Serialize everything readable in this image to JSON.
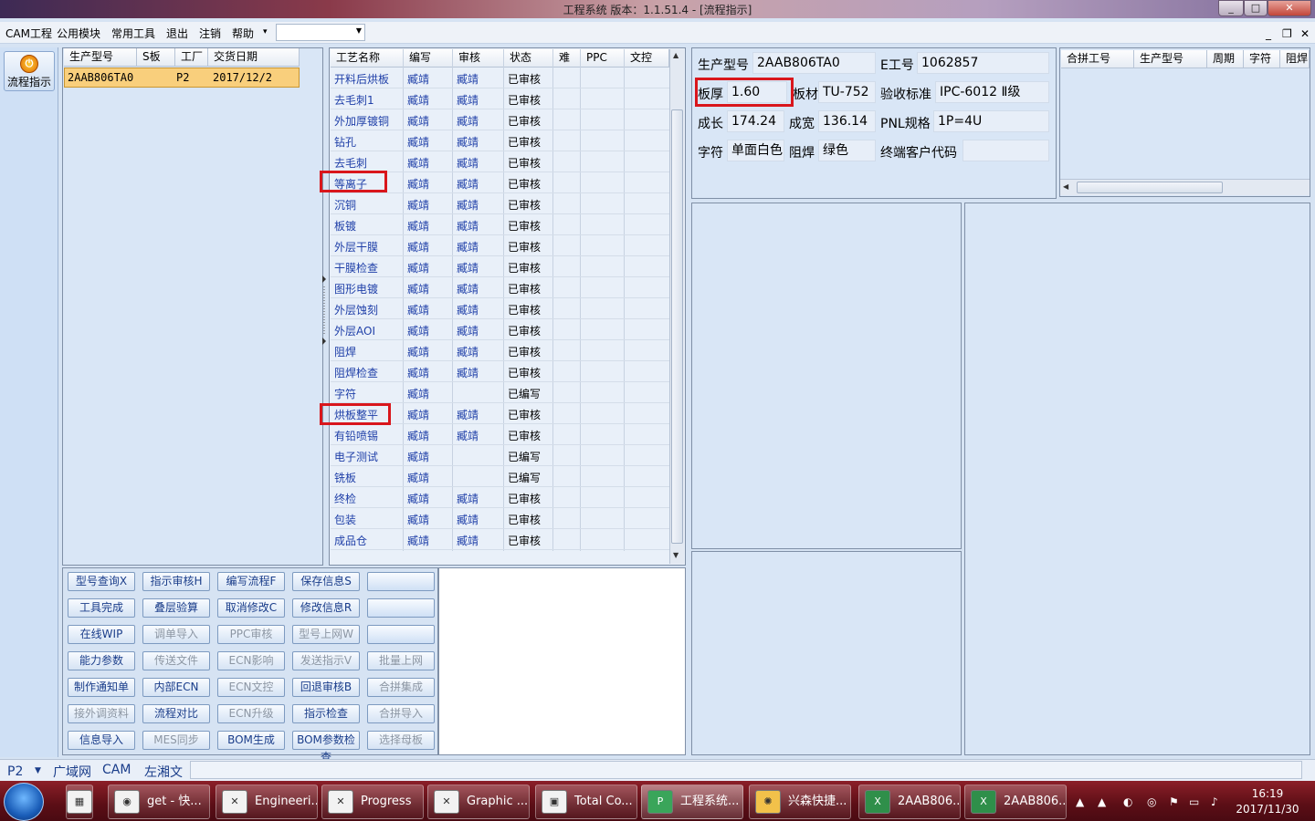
{
  "window": {
    "title": "工程系统   版本：1.1.51.4 - [流程指示]",
    "btn_min": "_",
    "btn_max": "□",
    "btn_close": "✕"
  },
  "menu": {
    "items": [
      "CAM工程",
      "公用模块",
      "常用工具",
      "退出",
      "注销",
      "帮助"
    ],
    "help_arrow": "▾",
    "combo_value": "",
    "mdi_min": "_",
    "mdi_restore": "❐",
    "mdi_close": "✕"
  },
  "left": {
    "flow_button": "流程指示",
    "flow_icon": "⏻"
  },
  "orders": {
    "headers": [
      "生产型号",
      "S板",
      "工厂",
      "交货日期"
    ],
    "row": {
      "model": "2AAB806TA0",
      "s_board": "",
      "factory": "P2",
      "date": "2017/12/2"
    }
  },
  "process": {
    "headers": [
      "工艺名称",
      "编写",
      "审核",
      "状态",
      "难",
      "PPC",
      "文控"
    ],
    "rows": [
      {
        "name": "开料后烘板",
        "writer": "臧靖",
        "checker": "臧靖",
        "status": "已审核"
      },
      {
        "name": "去毛刺1",
        "writer": "臧靖",
        "checker": "臧靖",
        "status": "已审核"
      },
      {
        "name": "外加厚镀铜",
        "writer": "臧靖",
        "checker": "臧靖",
        "status": "已审核"
      },
      {
        "name": "钻孔",
        "writer": "臧靖",
        "checker": "臧靖",
        "status": "已审核"
      },
      {
        "name": "去毛刺",
        "writer": "臧靖",
        "checker": "臧靖",
        "status": "已审核"
      },
      {
        "name": "等离子",
        "writer": "臧靖",
        "checker": "臧靖",
        "status": "已审核"
      },
      {
        "name": "沉铜",
        "writer": "臧靖",
        "checker": "臧靖",
        "status": "已审核"
      },
      {
        "name": "板镀",
        "writer": "臧靖",
        "checker": "臧靖",
        "status": "已审核"
      },
      {
        "name": "外层干膜",
        "writer": "臧靖",
        "checker": "臧靖",
        "status": "已审核"
      },
      {
        "name": "干膜检查",
        "writer": "臧靖",
        "checker": "臧靖",
        "status": "已审核"
      },
      {
        "name": "图形电镀",
        "writer": "臧靖",
        "checker": "臧靖",
        "status": "已审核"
      },
      {
        "name": "外层蚀刻",
        "writer": "臧靖",
        "checker": "臧靖",
        "status": "已审核"
      },
      {
        "name": "外层AOI",
        "writer": "臧靖",
        "checker": "臧靖",
        "status": "已审核"
      },
      {
        "name": "阻焊",
        "writer": "臧靖",
        "checker": "臧靖",
        "status": "已审核"
      },
      {
        "name": "阻焊检查",
        "writer": "臧靖",
        "checker": "臧靖",
        "status": "已审核"
      },
      {
        "name": "字符",
        "writer": "臧靖",
        "checker": "",
        "status": "已编写"
      },
      {
        "name": "烘板整平",
        "writer": "臧靖",
        "checker": "臧靖",
        "status": "已审核"
      },
      {
        "name": "有铅喷锡",
        "writer": "臧靖",
        "checker": "臧靖",
        "status": "已审核"
      },
      {
        "name": "电子测试",
        "writer": "臧靖",
        "checker": "",
        "status": "已编写"
      },
      {
        "name": "铣板",
        "writer": "臧靖",
        "checker": "",
        "status": "已编写"
      },
      {
        "name": "终检",
        "writer": "臧靖",
        "checker": "臧靖",
        "status": "已审核"
      },
      {
        "name": "包装",
        "writer": "臧靖",
        "checker": "臧靖",
        "status": "已审核"
      },
      {
        "name": "成品仓",
        "writer": "臧靖",
        "checker": "臧靖",
        "status": "已审核"
      }
    ]
  },
  "actions": [
    [
      "型号查询X",
      "指示审核H",
      "编写流程F",
      "保存信息S",
      ""
    ],
    [
      "工具完成",
      "叠层验算",
      "取消修改C",
      "修改信息R",
      ""
    ],
    [
      "在线WIP",
      "调单导入",
      "PPC审核",
      "型号上网W",
      ""
    ],
    [
      "能力参数",
      "传送文件",
      "ECN影响",
      "发送指示V",
      "批量上网"
    ],
    [
      "制作通知单",
      "内部ECN",
      "ECN文控",
      "回退审核B",
      "合拼集成"
    ],
    [
      "接外调资料",
      "流程对比",
      "ECN升级",
      "指示检查",
      "合拼导入"
    ],
    [
      "信息导入",
      "MES同步",
      "BOM生成",
      "BOM参数检查",
      "选择母板"
    ]
  ],
  "info": {
    "model_label": "生产型号",
    "model": "2AAB806TA0",
    "eno_label": "E工号",
    "eno": "1062857",
    "thick_label": "板厚",
    "thick": "1.60",
    "mat_label": "板材",
    "mat": "TU-752",
    "std_label": "验收标准",
    "std": "IPC-6012 Ⅱ级",
    "len_label": "成长",
    "len": "174.24",
    "wid_label": "成宽",
    "wid": "136.14",
    "pnl_label": "PNL规格",
    "pnl": "1P=4U",
    "char_label": "字符",
    "char": "单面白色",
    "mask_label": "阻焊",
    "mask": "绿色",
    "cust_label": "终端客户代码",
    "cust": ""
  },
  "merge": {
    "headers": [
      "合拼工号",
      "生产型号",
      "周期",
      "字符",
      "阻焊"
    ]
  },
  "status": {
    "factory": "P2",
    "items": [
      "广域网",
      "CAM",
      "左湘文"
    ]
  },
  "taskbar": {
    "items": [
      "get - 快...",
      "Engineeri...",
      "Progress",
      "Graphic ...",
      "Total Co...",
      "工程系统...",
      "兴森快捷...",
      "2AAB806...",
      "2AAB806..."
    ],
    "time": "16:19",
    "date": "2017/11/30"
  }
}
